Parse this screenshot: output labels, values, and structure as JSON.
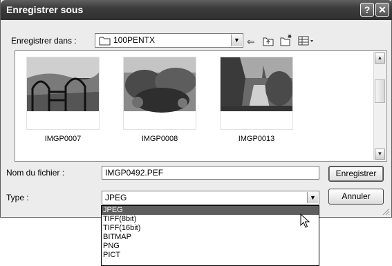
{
  "window": {
    "title": "Enregistrer sous",
    "help_label": "?",
    "close_label": "✕"
  },
  "save_in": {
    "label": "Enregistrer dans :",
    "value": "100PENTX"
  },
  "files": [
    {
      "name": "IMGP0007"
    },
    {
      "name": "IMGP0008"
    },
    {
      "name": "IMGP0013"
    }
  ],
  "filename": {
    "label": "Nom du fichier :",
    "value": "IMGP0492.PEF"
  },
  "type": {
    "label": "Type :",
    "value": "JPEG",
    "options": [
      "JPEG",
      "TIFF(8bit)",
      "TIFF(16bit)",
      "BITMAP",
      "PNG",
      "PICT"
    ],
    "selected": "JPEG"
  },
  "buttons": {
    "save": "Enregistrer",
    "cancel": "Annuler"
  },
  "icons": {
    "help": "help-icon",
    "close": "close-icon",
    "folder": "folder-icon",
    "back": "back-arrow-icon",
    "up": "up-folder-icon",
    "new_folder": "new-folder-icon",
    "views": "view-menu-icon",
    "dropdown": "chevron-down-icon",
    "pointer": "mouse-pointer-icon"
  }
}
